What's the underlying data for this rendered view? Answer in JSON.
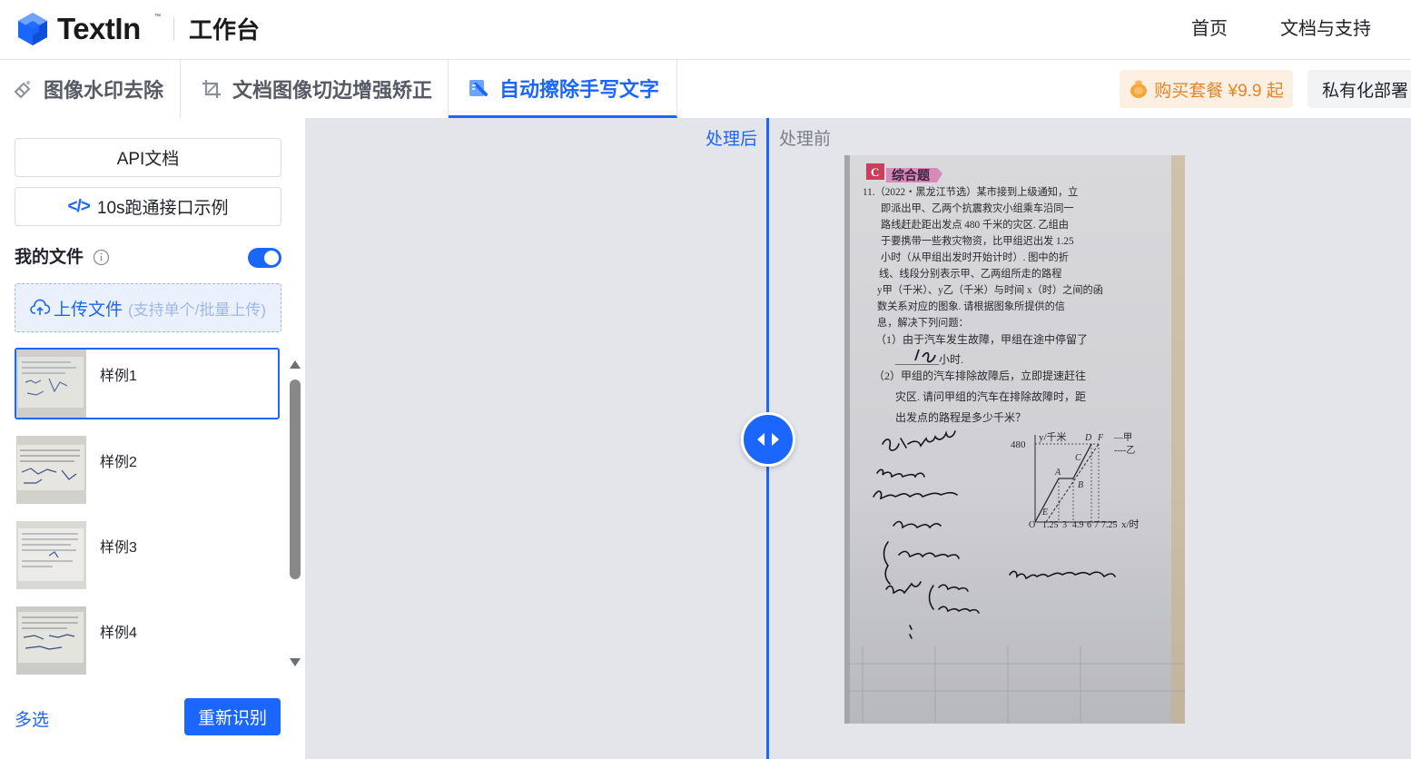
{
  "header": {
    "logo_text": "TextIn",
    "logo_subtitle": "工作台",
    "nav": [
      "首页",
      "文档与支持"
    ]
  },
  "tools": {
    "tabs": [
      {
        "label": "图像水印去除",
        "icon": "watermark-eraser-icon"
      },
      {
        "label": "文档图像切边增强矫正",
        "icon": "crop-icon"
      },
      {
        "label": "自动擦除手写文字",
        "icon": "handwriting-erase-icon",
        "active": true
      }
    ],
    "buy_label": "购买套餐 ¥9.9 起",
    "private_label": "私有化部署"
  },
  "sidebar": {
    "api_doc_label": "API文档",
    "demo_label": "10s跑通接口示例",
    "my_files_label": "我的文件",
    "upload_label": "上传文件",
    "upload_hint": "(支持单个/批量上传)",
    "files": [
      {
        "name": "样例1",
        "selected": true
      },
      {
        "name": "样例2"
      },
      {
        "name": "样例3"
      },
      {
        "name": "样例4"
      }
    ],
    "multi_select_label": "多选",
    "rerecognize_label": "重新识别"
  },
  "preview": {
    "after_label": "处理后",
    "before_label": "处理前",
    "document": {
      "section_badge": "C",
      "section_title": "综合题",
      "problem_text": [
        "11.（2022・黑龙江节选）某市接到上级通知，立",
        "即派出甲、乙两个抗震救灾小组乘车沿同一",
        "路线赶赴距出发点 480 千米的灾区. 乙组由",
        "于要携带一些救灾物资，比甲组迟出发 1.25",
        "小时（从甲组出发时开始计时）. 图中的折",
        "线、线段分别表示甲、乙两组所走的路程",
        "y甲（千米）、y乙（千米）与时间 x（时）之间的函",
        "数关系对应的图象. 请根据图象所提供的信",
        "息，解决下列问题：",
        "（1）由于汽车发生故障，甲组在途中停留了",
        "________小时.",
        "（2）甲组的汽车排除故障后，立即提速赶往",
        "灾区. 请问甲组的汽车在排除故障时，距",
        "出发点的路程是多少千米？"
      ],
      "graph": {
        "y_axis_label": "y/千米",
        "x_axis_label": "x/时",
        "y_tick": "480",
        "x_ticks": [
          "O",
          "1.25",
          "3",
          "4.9",
          "6",
          "7",
          "7.25"
        ],
        "point_labels": [
          "A",
          "B",
          "C",
          "D",
          "E",
          "F"
        ],
        "legend": [
          "—甲",
          "----乙"
        ]
      }
    }
  }
}
